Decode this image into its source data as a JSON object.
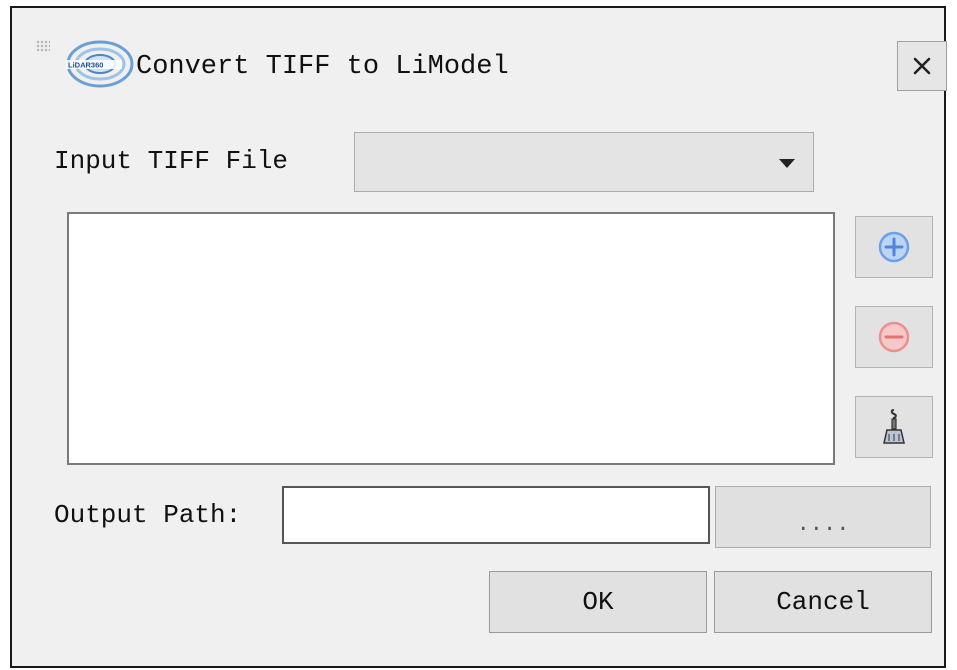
{
  "window": {
    "title": "Convert TIFF to LiModel",
    "logo_text": "LiDAR360",
    "close_glyph": "✕"
  },
  "input": {
    "label": "Input TIFF File",
    "selected_value": ""
  },
  "file_list": {
    "items": []
  },
  "side_buttons": {
    "add_icon": "plus-circle-icon",
    "remove_icon": "minus-circle-icon",
    "clear_icon": "broom-icon"
  },
  "output": {
    "label": "Output Path:",
    "value": "",
    "browse_label": "...."
  },
  "footer": {
    "ok_label": "OK",
    "cancel_label": "Cancel"
  },
  "colors": {
    "add_blue": "#6d9eea",
    "remove_red": "#ee8f8f",
    "dialog_bg": "#f0f0f0"
  }
}
